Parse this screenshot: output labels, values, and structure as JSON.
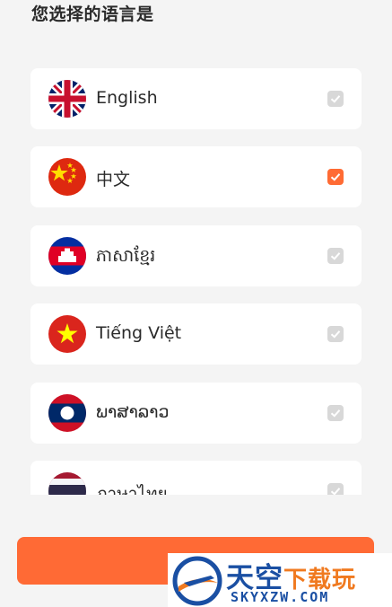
{
  "header": {
    "title": "您选择的语言是"
  },
  "languages": [
    {
      "label": "English",
      "flag": "uk-flag-icon",
      "selected": false
    },
    {
      "label": "中文",
      "flag": "china-flag-icon",
      "selected": true
    },
    {
      "label": "ភាសាខ្មែរ",
      "flag": "cambodia-flag-icon",
      "selected": false
    },
    {
      "label": "Tiếng Việt",
      "flag": "vietnam-flag-icon",
      "selected": false
    },
    {
      "label": "ພາສາລາວ",
      "flag": "laos-flag-icon",
      "selected": false
    },
    {
      "label": "ภาษาไทย",
      "flag": "thailand-flag-icon",
      "selected": false
    }
  ],
  "colors": {
    "accent": "#ff6b34",
    "unchecked": "#d8d8d8",
    "card": "#ffffff",
    "background": "#f4f4f4"
  },
  "watermark": {
    "brand_main": "天空",
    "brand_accent": "下载玩",
    "url": "SKYXZW.COM"
  }
}
